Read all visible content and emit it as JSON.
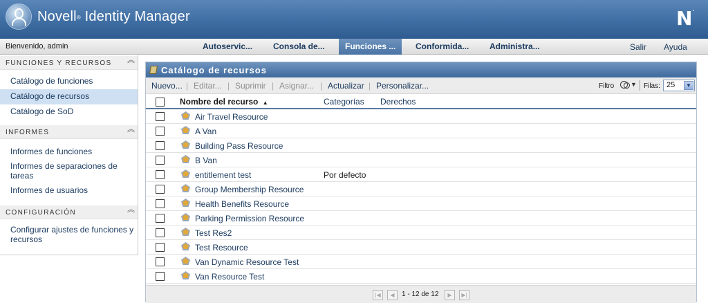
{
  "header": {
    "app_name": "Novell",
    "reg_mark": "®",
    "product": "Identity Manager",
    "brand_letter": "N",
    "brand_dot": "."
  },
  "nav": {
    "welcome": "Bienvenido, admin",
    "tabs": [
      {
        "label": "Autoservic...",
        "active": false
      },
      {
        "label": "Consola de...",
        "active": false
      },
      {
        "label": "Funciones ...",
        "active": true
      },
      {
        "label": "Conformida...",
        "active": false
      },
      {
        "label": "Administra...",
        "active": false
      }
    ],
    "links": [
      {
        "label": "Salir"
      },
      {
        "label": "Ayuda"
      }
    ]
  },
  "sidebar": {
    "sections": [
      {
        "title": "FUNCIONES Y RECURSOS",
        "items": [
          {
            "label": "Catálogo de funciones",
            "selected": false
          },
          {
            "label": "Catálogo de recursos",
            "selected": true
          },
          {
            "label": "Catálogo de SoD",
            "selected": false
          }
        ]
      },
      {
        "title": "INFORMES",
        "items": [
          {
            "label": "Informes de funciones"
          },
          {
            "label": "Informes de separaciones de tareas"
          },
          {
            "label": "Informes de usuarios"
          }
        ]
      },
      {
        "title": "CONFIGURACIÓN",
        "items": [
          {
            "label": "Configurar ajustes de funciones y recursos"
          }
        ]
      }
    ],
    "collapse_glyph": "︽"
  },
  "panel": {
    "title": "Catálogo de recursos",
    "toolbar": {
      "buttons": [
        {
          "label": "Nuevo...",
          "enabled": true
        },
        {
          "label": "Editar...",
          "enabled": false
        },
        {
          "label": "Suprimir",
          "enabled": false
        },
        {
          "label": "Asignar...",
          "enabled": false
        },
        {
          "label": "Actualizar",
          "enabled": true
        },
        {
          "label": "Personalizar...",
          "enabled": true
        }
      ],
      "separator": "|",
      "filter_label": "Filtro",
      "rows_label": "Filas:",
      "rows_value": "25",
      "caret": "▼"
    },
    "columns": {
      "name": "Nombre del recurso",
      "sort_glyph": "▲",
      "categories": "Categorías",
      "rights": "Derechos"
    },
    "rows": [
      {
        "name": "Air Travel Resource",
        "category": ""
      },
      {
        "name": "A Van",
        "category": ""
      },
      {
        "name": "Building Pass Resource",
        "category": ""
      },
      {
        "name": "B Van",
        "category": ""
      },
      {
        "name": "entitlement test",
        "category": "Por defecto"
      },
      {
        "name": "Group Membership Resource",
        "category": ""
      },
      {
        "name": "Health Benefits Resource",
        "category": ""
      },
      {
        "name": "Parking Permission Resource",
        "category": ""
      },
      {
        "name": "Test Res2",
        "category": ""
      },
      {
        "name": "Test Resource",
        "category": ""
      },
      {
        "name": "Van Dynamic Resource Test",
        "category": ""
      },
      {
        "name": "Van Resource Test",
        "category": ""
      }
    ],
    "pager": {
      "text": "1 - 12 de 12",
      "first": "|◀",
      "prev": "◀",
      "next": "▶",
      "last": "▶|"
    }
  }
}
